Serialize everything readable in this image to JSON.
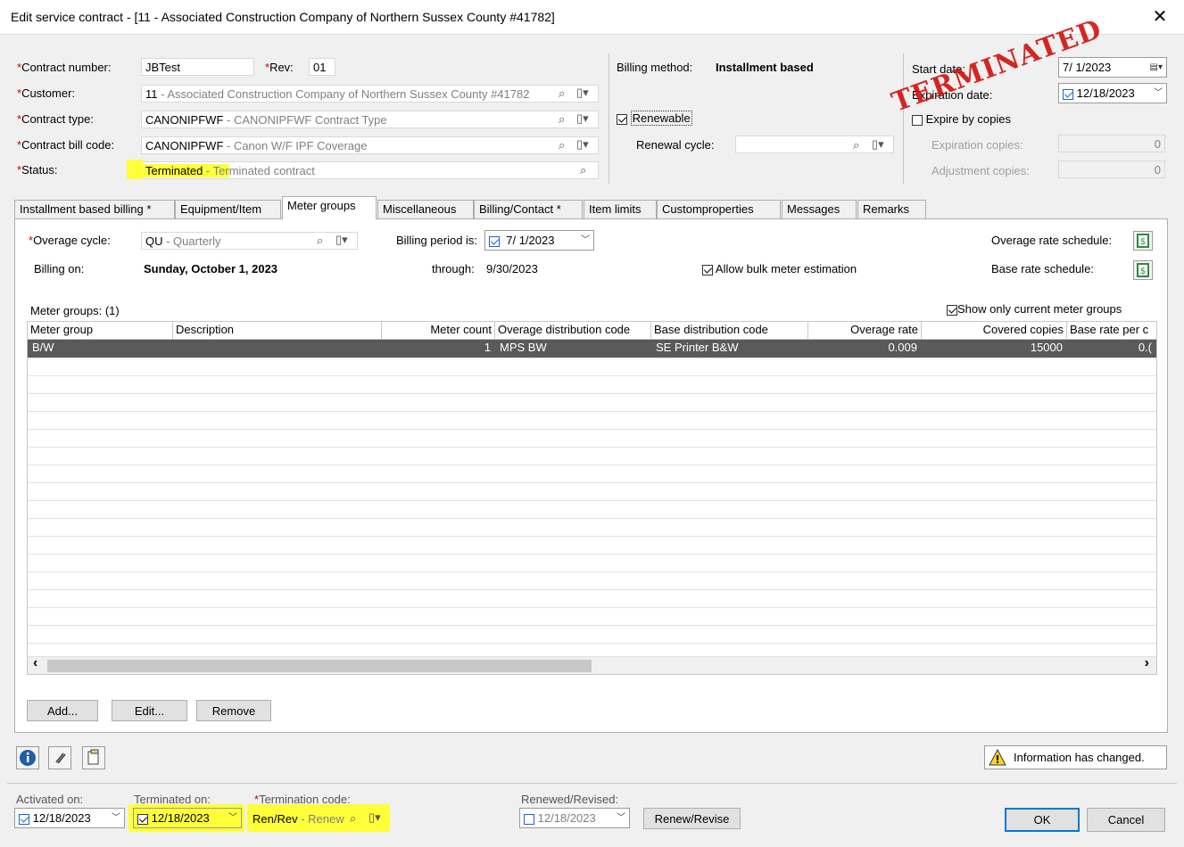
{
  "window": {
    "title": "Edit service contract - [11 - Associated Construction Company of Northern Sussex County #41782]",
    "close": "✕"
  },
  "header": {
    "contract_number_label": "Contract number:",
    "contract_number_value": "JBTest",
    "rev_label": "Rev:",
    "rev_value": "01",
    "customer_label": "Customer:",
    "customer_code": "11",
    "customer_desc": " - Associated Construction Company of Northern Sussex County #41782",
    "contract_type_label": "Contract type:",
    "contract_type_code": "CANONIPFWF",
    "contract_type_desc": " - CANONIPFWF Contract Type",
    "bill_code_label": "Contract bill code:",
    "bill_code_code": "CANONIPFWF",
    "bill_code_desc": " - Canon W/F IPF Coverage",
    "status_label": "Status:",
    "status_code": "Terminated",
    "status_desc_hl": " - Ter",
    "status_desc": "minated contract",
    "required_mark": "*"
  },
  "billing": {
    "method_label": "Billing method:",
    "method_value": "Installment based",
    "renewable_label": "Renewable",
    "renewal_cycle_label": "Renewal cycle:"
  },
  "dates": {
    "start_label": "Start date:",
    "start_value": "7/ 1/2023",
    "expiration_label": "Expiration date:",
    "expiration_value": "12/18/2023",
    "expire_by_copies_label": "Expire by copies",
    "expiration_copies_label": "Expiration copies:",
    "expiration_copies_value": "0",
    "adjustment_copies_label": "Adjustment copies:",
    "adjustment_copies_value": "0",
    "stamp": "TERMINATED"
  },
  "tabs": [
    {
      "label": "Installment based billing *"
    },
    {
      "label": "Equipment/Item"
    },
    {
      "label": "Meter groups"
    },
    {
      "label": "Miscellaneous"
    },
    {
      "label": "Billing/Contact *"
    },
    {
      "label": "Item limits"
    },
    {
      "label": "Customproperties"
    },
    {
      "label": "Messages"
    },
    {
      "label": "Remarks"
    }
  ],
  "meter": {
    "overage_cycle_label": "Overage cycle:",
    "overage_cycle_code": "QU",
    "overage_cycle_desc": " - Quarterly",
    "billing_period_label": "Billing period is:",
    "billing_period_value": "7/ 1/2023",
    "billing_on_label": "Billing on:",
    "billing_on_value": "Sunday, October 1, 2023",
    "through_label": "through:",
    "through_value": "9/30/2023",
    "allow_bulk_label": "Allow bulk meter estimation",
    "overage_rate_schedule_label": "Overage rate schedule:",
    "base_rate_schedule_label": "Base rate schedule:",
    "groups_count_label": "Meter groups: (1)",
    "show_current_label": "Show only current meter groups"
  },
  "grid": {
    "columns": [
      "Meter group",
      "Description",
      "Meter count",
      "Overage distribution code",
      "Base distribution code",
      "Overage rate",
      "Covered copies",
      "Base rate per c"
    ],
    "rows": [
      {
        "meter_group": "B/W",
        "description": "",
        "meter_count": "1",
        "overage_dist": "MPS BW",
        "base_dist": "SE Printer B&W",
        "overage_rate": "0.009",
        "covered_copies": "15000",
        "base_rate": "0.("
      }
    ]
  },
  "panel_buttons": {
    "add": "Add...",
    "edit": "Edit...",
    "remove": "Remove"
  },
  "scroll": {
    "left": "‹",
    "right": "›"
  },
  "info": {
    "text": "Information has changed.",
    "warn_glyph": "!"
  },
  "footer": {
    "activated_label": "Activated on:",
    "activated_value": "12/18/2023",
    "terminated_label": "Terminated on:",
    "terminated_value": "12/18/2023",
    "termination_code_label": "Termination code:",
    "termination_code": "Ren/Rev",
    "termination_desc": " - Renew",
    "renewed_label": "Renewed/Revised:",
    "renewed_value": "12/18/2023",
    "renew_revise_button": "Renew/Revise",
    "ok": "OK",
    "cancel": "Cancel"
  },
  "colors": {
    "highlight": "#ffff3a",
    "selected_row": "#5a5a5a",
    "required": "#d00000",
    "stamp": "#d21010"
  }
}
